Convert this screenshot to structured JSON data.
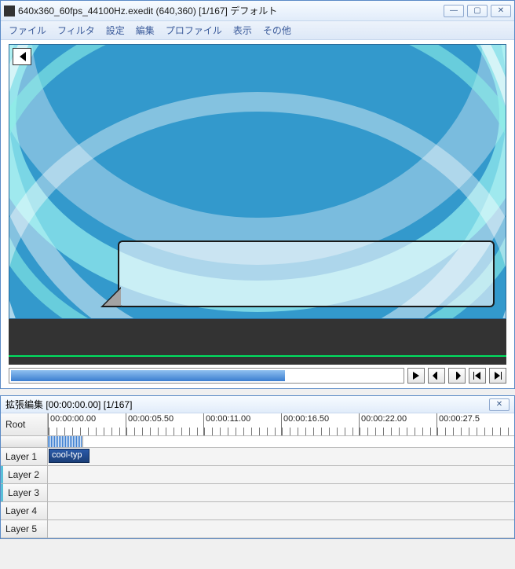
{
  "main_window": {
    "title": "640x360_60fps_44100Hz.exedit (640,360) [1/167] デフォルト"
  },
  "menu": {
    "file": "ファイル",
    "filter": "フィルタ",
    "settings": "設定",
    "edit": "編集",
    "profile": "プロファイル",
    "view": "表示",
    "other": "その他"
  },
  "timeline_window": {
    "title": "拡張編集 [00:00:00.00] [1/167]",
    "root": "Root"
  },
  "ruler": [
    "00:00:00.00",
    "00:00:05.50",
    "00:00:11.00",
    "00:00:16.50",
    "00:00:22.00",
    "00:00:27.5"
  ],
  "layers": {
    "l1": "Layer 1",
    "l2": "Layer 2",
    "l3": "Layer 3",
    "l4": "Layer 4",
    "l5": "Layer 5"
  },
  "clip": {
    "name": "cool-typ"
  }
}
